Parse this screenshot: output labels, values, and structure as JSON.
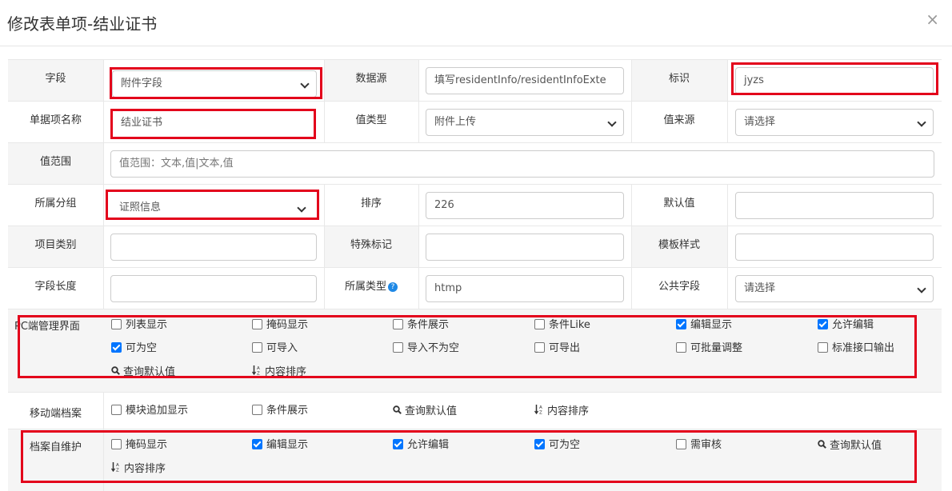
{
  "header": {
    "title": "修改表单项-结业证书",
    "close": "×"
  },
  "labels": {
    "field": "字段",
    "datasource": "数据源",
    "identifier": "标识",
    "item_name": "单据项名称",
    "value_type": "值类型",
    "value_source": "值来源",
    "value_range": "值范围",
    "group": "所属分组",
    "order": "排序",
    "default": "默认值",
    "category": "项目类别",
    "special": "特殊标记",
    "template": "模板样式",
    "length": "字段长度",
    "belong_type": "所属类型",
    "public_field": "公共字段",
    "pc": "PC端管理界面",
    "mobile": "移动端档案",
    "self": "档案自维护"
  },
  "fields": {
    "field_select": "附件字段",
    "datasource_value": "填写residentInfo/residentInfoExte",
    "identifier_value": "jyzs",
    "item_name_value": "结业证书",
    "value_type_select": "附件上传",
    "value_source_select": "请选择",
    "value_range_placeholder": "值范围：文本,值|文本,值",
    "group_select": "证照信息",
    "order_value": "226",
    "default_value": "",
    "category_value": "",
    "special_value": "",
    "template_value": "",
    "length_value": "",
    "belong_type_value": "htmp",
    "public_field_select": "请选择"
  },
  "pc_options": [
    {
      "label": "列表显示",
      "checked": false
    },
    {
      "label": "掩码显示",
      "checked": false
    },
    {
      "label": "条件展示",
      "checked": false
    },
    {
      "label": "条件Like",
      "checked": false
    },
    {
      "label": "编辑显示",
      "checked": true
    },
    {
      "label": "允许编辑",
      "checked": true
    },
    {
      "label": "可为空",
      "checked": true
    },
    {
      "label": "可导入",
      "checked": false
    },
    {
      "label": "导入不为空",
      "checked": false
    },
    {
      "label": "可导出",
      "checked": false
    },
    {
      "label": "可批量调整",
      "checked": false
    },
    {
      "label": "标准接口输出",
      "checked": false
    }
  ],
  "pc_links": [
    "查询默认值",
    "内容排序"
  ],
  "mobile_options": [
    {
      "label": "模块追加显示",
      "checked": false
    },
    {
      "label": "条件展示",
      "checked": false
    }
  ],
  "mobile_links": [
    "查询默认值",
    "内容排序"
  ],
  "self_options": [
    {
      "label": "掩码显示",
      "checked": false
    },
    {
      "label": "编辑显示",
      "checked": true
    },
    {
      "label": "允许编辑",
      "checked": true
    },
    {
      "label": "可为空",
      "checked": true
    },
    {
      "label": "需审核",
      "checked": false
    }
  ],
  "self_links": [
    "查询默认值",
    "内容排序"
  ],
  "colors": {
    "highlight": "#e3001b",
    "checkbox": "#0075ff",
    "help_icon": "#1e88e5"
  }
}
